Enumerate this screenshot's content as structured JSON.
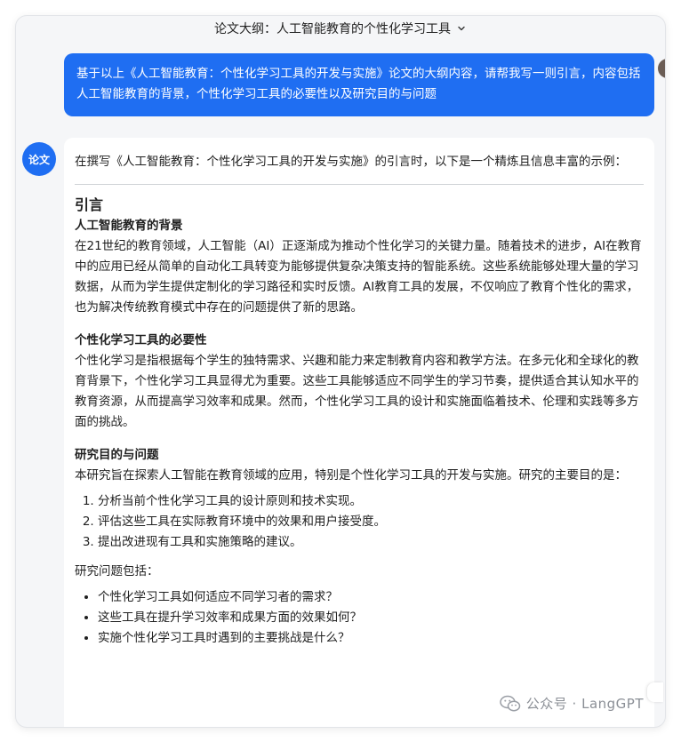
{
  "header": {
    "title": "论文大纲：人工智能教育的个性化学习工具"
  },
  "user_message": {
    "text": "基于以上《人工智能教育：个性化学习工具的开发与实施》论文的大纲内容，请帮我写一则引言，内容包括人工智能教育的背景，个性化学习工具的必要性以及研究目的与问题"
  },
  "assistant": {
    "avatar_label": "论文",
    "intro": "在撰写《人工智能教育：个性化学习工具的开发与实施》的引言时，以下是一个精炼且信息丰富的示例：",
    "section_title": "引言",
    "background_heading": "人工智能教育的背景",
    "background_text": "在21世纪的教育领域，人工智能（AI）正逐渐成为推动个性化学习的关键力量。随着技术的进步，AI在教育中的应用已经从简单的自动化工具转变为能够提供复杂决策支持的智能系统。这些系统能够处理大量的学习数据，从而为学生提供定制化的学习路径和实时反馈。AI教育工具的发展，不仅响应了教育个性化的需求，也为解决传统教育模式中存在的问题提供了新的思路。",
    "necessity_heading": "个性化学习工具的必要性",
    "necessity_text": "个性化学习是指根据每个学生的独特需求、兴趣和能力来定制教育内容和教学方法。在多元化和全球化的教育背景下，个性化学习工具显得尤为重要。这些工具能够适应不同学生的学习节奏，提供适合其认知水平的教育资源，从而提高学习效率和成果。然而，个性化学习工具的设计和实施面临着技术、伦理和实践等多方面的挑战。",
    "purpose_heading": "研究目的与问题",
    "purpose_text": "本研究旨在探索人工智能在教育领域的应用，特别是个性化学习工具的开发与实施。研究的主要目的是：",
    "purposes": [
      "分析当前个性化学习工具的设计原则和技术实现。",
      "评估这些工具在实际教育环境中的效果和用户接受度。",
      "提出改进现有工具和实施策略的建议。"
    ],
    "questions_label": "研究问题包括：",
    "questions": [
      "个性化学习工具如何适应不同学习者的需求？",
      "这些工具在提升学习效率和成果方面的效果如何？",
      "实施个性化学习工具时遇到的主要挑战是什么？"
    ]
  },
  "watermark": {
    "text": "公众号 · LangGPT"
  },
  "colors": {
    "accent": "#1f6ef2",
    "window_bg": "#f5f6f8",
    "card_bg": "#ffffff",
    "watermark": "#8b8f96"
  },
  "icons": {
    "header_toggle": "chevron-down-icon",
    "watermark": "wechat-icon"
  }
}
